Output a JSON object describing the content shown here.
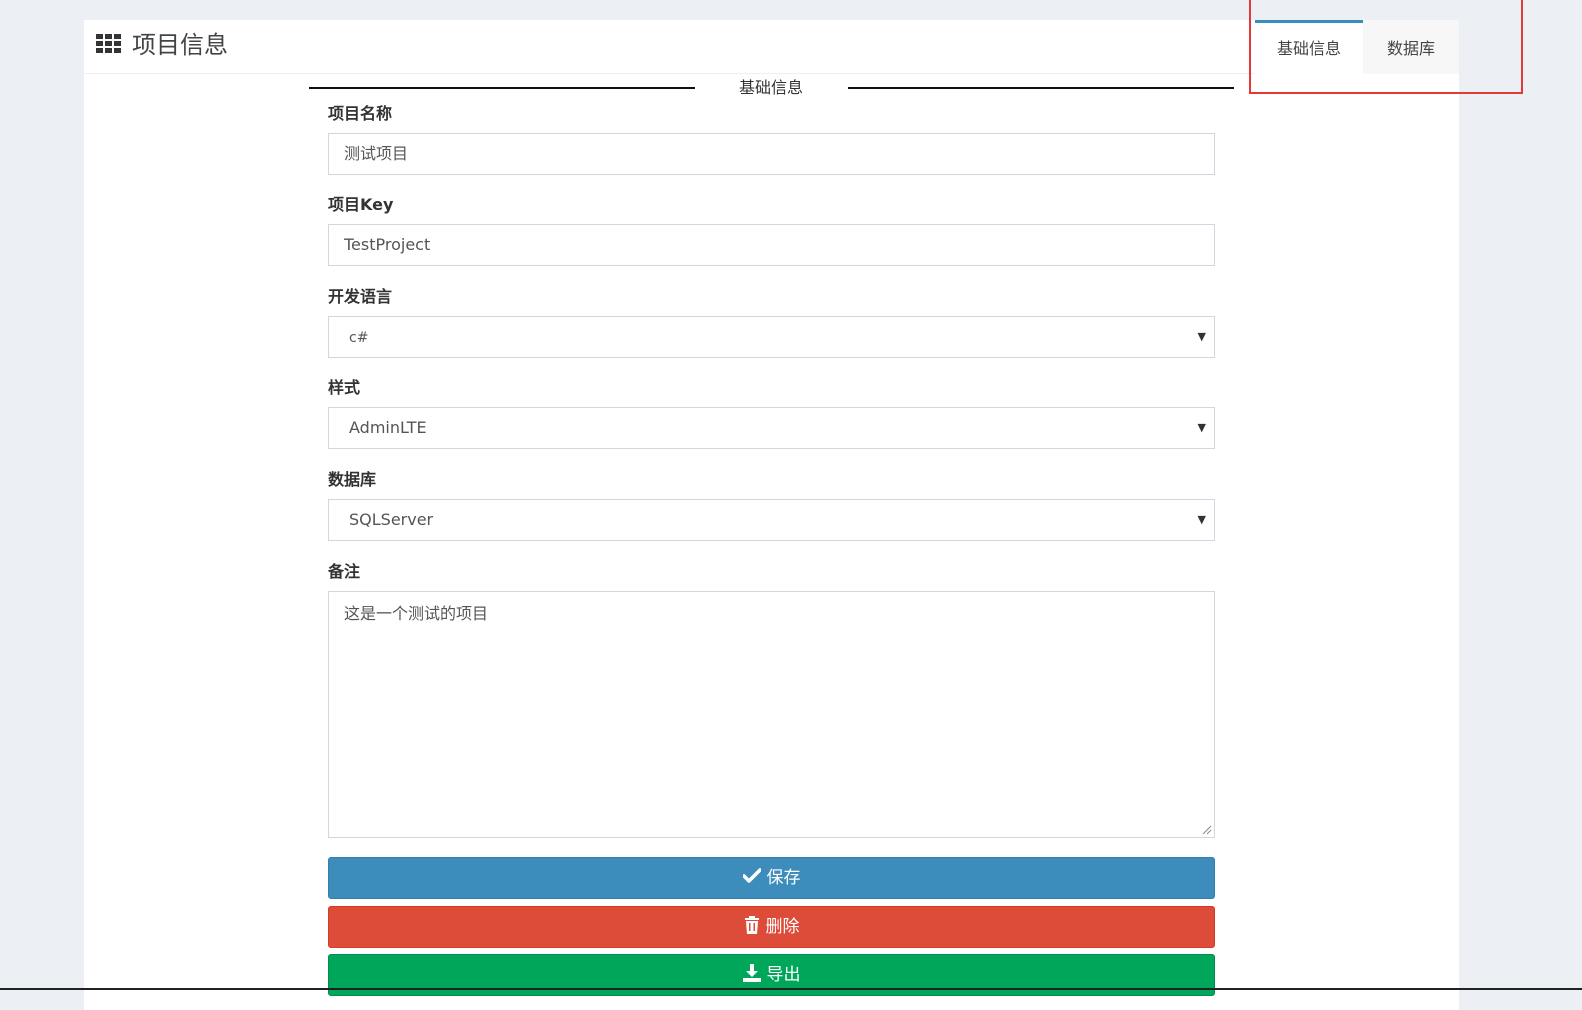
{
  "header": {
    "title": "项目信息",
    "icon": "grid-icon"
  },
  "tabs": [
    {
      "label": "基础信息",
      "active": true
    },
    {
      "label": "数据库",
      "active": false
    }
  ],
  "section": {
    "title": "基础信息"
  },
  "form": {
    "project_name": {
      "label": "项目名称",
      "value": "测试项目"
    },
    "project_key": {
      "label": "项目Key",
      "value": "TestProject"
    },
    "language": {
      "label": "开发语言",
      "value": "c#"
    },
    "style": {
      "label": "样式",
      "value": "AdminLTE"
    },
    "database": {
      "label": "数据库",
      "value": "SQLServer"
    },
    "remark": {
      "label": "备注",
      "value": "这是一个测试的项目"
    }
  },
  "buttons": {
    "save": "保存",
    "delete": "删除",
    "export": "导出"
  },
  "colors": {
    "primary": "#3c8dbc",
    "danger": "#dd4b39",
    "success": "#00a65a",
    "highlight": "#e53935"
  }
}
